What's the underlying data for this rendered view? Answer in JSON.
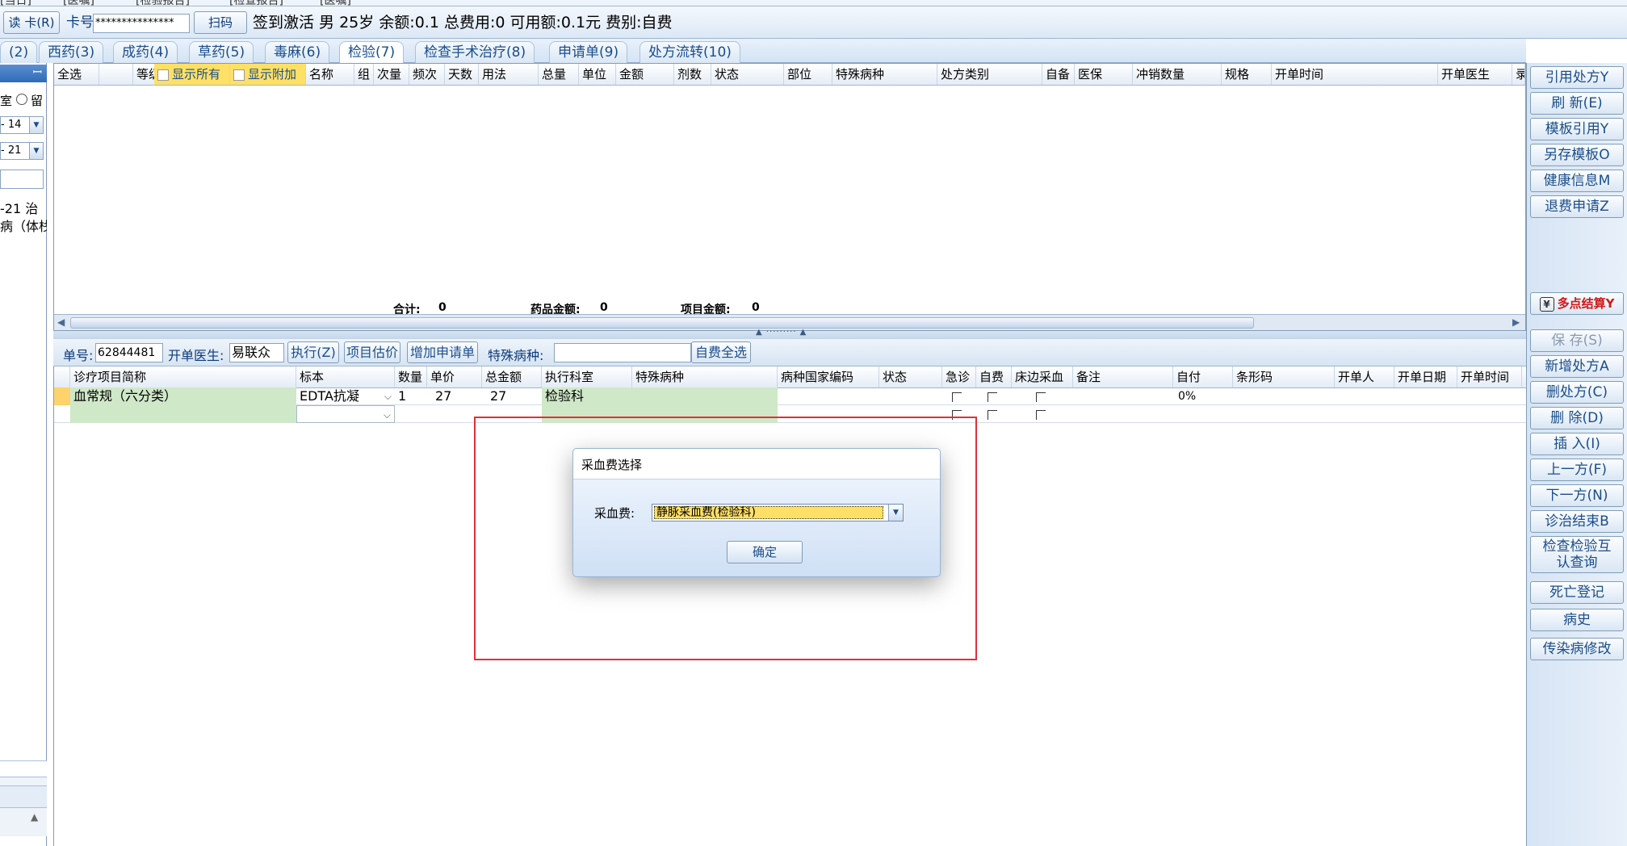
{
  "top_strip": {
    "items": [
      "[当日]",
      "[医嘱]",
      "[检验报告]",
      "[检查报告]",
      "[医嘱]"
    ]
  },
  "patient_bar": {
    "read_card_label": "读 卡(R)",
    "card_no_label": "卡号",
    "card_no_value": "***************",
    "scan_label": "扫码",
    "info_text": "签到激活 男 25岁 余额:0.1 总费用:0 可用额:0.1元 费别:自费"
  },
  "tabs": [
    {
      "label": "(2)"
    },
    {
      "label": "西药(3)"
    },
    {
      "label": "成药(4)"
    },
    {
      "label": "草药(5)"
    },
    {
      "label": "毒麻(6)"
    },
    {
      "label": "检验(7)"
    },
    {
      "label": "检查手术治疗(8)"
    },
    {
      "label": "申请单(9)"
    },
    {
      "label": "处方流转(10)"
    }
  ],
  "left_panel": {
    "pin": "ꟷ",
    "room_radio1": "室",
    "room_radio2": "留",
    "date1": "- 14",
    "date2": "- 21",
    "history_line1": "-21 治",
    "history_line2": "病（体栈"
  },
  "upper_grid": {
    "headers": [
      "全选",
      "等级",
      "显示所有",
      "显示附加",
      "名称",
      "组",
      "次量",
      "频次",
      "天数",
      "用法",
      "总量",
      "单位",
      "金额",
      "剂数",
      "状态",
      "部位",
      "特殊病种",
      "处方类别",
      "自备",
      "医保",
      "冲销数量",
      "规格",
      "开单时间",
      "开单医生",
      "录入"
    ],
    "totals_label": "合计:",
    "totals_value": "0",
    "drug_amount_label": "药品金额:",
    "drug_amount_value": "0",
    "item_amount_label": "项目金额:",
    "item_amount_value": "0"
  },
  "lower_toolbar": {
    "order_no_label": "单号:",
    "order_no_value": "62844481",
    "doctor_label": "开单医生:",
    "doctor_value": "易联众",
    "execute_label": "执行(Z)",
    "estimate_label": "项目估价",
    "add_request_label": "增加申请单",
    "special_disease_label": "特殊病种:",
    "self_pay_all_label": "自费全选"
  },
  "lower_grid": {
    "headers": [
      "诊疗项目简称",
      "标本",
      "数量",
      "单价",
      "总金额",
      "执行科室",
      "特殊病种",
      "病种国家编码",
      "状态",
      "急诊",
      "自费",
      "床边采血",
      "备注",
      "自付",
      "条形码",
      "开单人",
      "开单日期",
      "开单时间"
    ],
    "rows": [
      {
        "name": "血常规（六分类）",
        "specimen": "EDTA抗凝",
        "qty": "1",
        "price": "27",
        "total": "27",
        "dept": "检验科",
        "self_ratio": "0%"
      }
    ]
  },
  "dialog": {
    "title": "采血费选择",
    "field_label": "采血费:",
    "selected_value": "静脉采血费(检验科)",
    "ok_label": "确定"
  },
  "sidebar": {
    "top_buttons": [
      "引用处方Y",
      "刷 新(E)",
      "模板引用Y",
      "另存模板O",
      "健康信息M",
      "退费申请Z"
    ],
    "multi_settle": "多点结算Y",
    "bottom_buttons": [
      "保 存(S)",
      "新增处方A",
      "删处方(C)",
      "删 除(D)",
      "插 入(I)",
      "上一方(F)",
      "下一方(N)",
      "诊治结束B",
      "检查检验互认查询",
      "死亡登记",
      "病史",
      "传染病修改"
    ]
  },
  "colors": {
    "accent": "#1a4d8c",
    "highlight_yellow": "#ffe066",
    "green_cell": "#cfe8c8",
    "red_box": "#e0303a"
  }
}
